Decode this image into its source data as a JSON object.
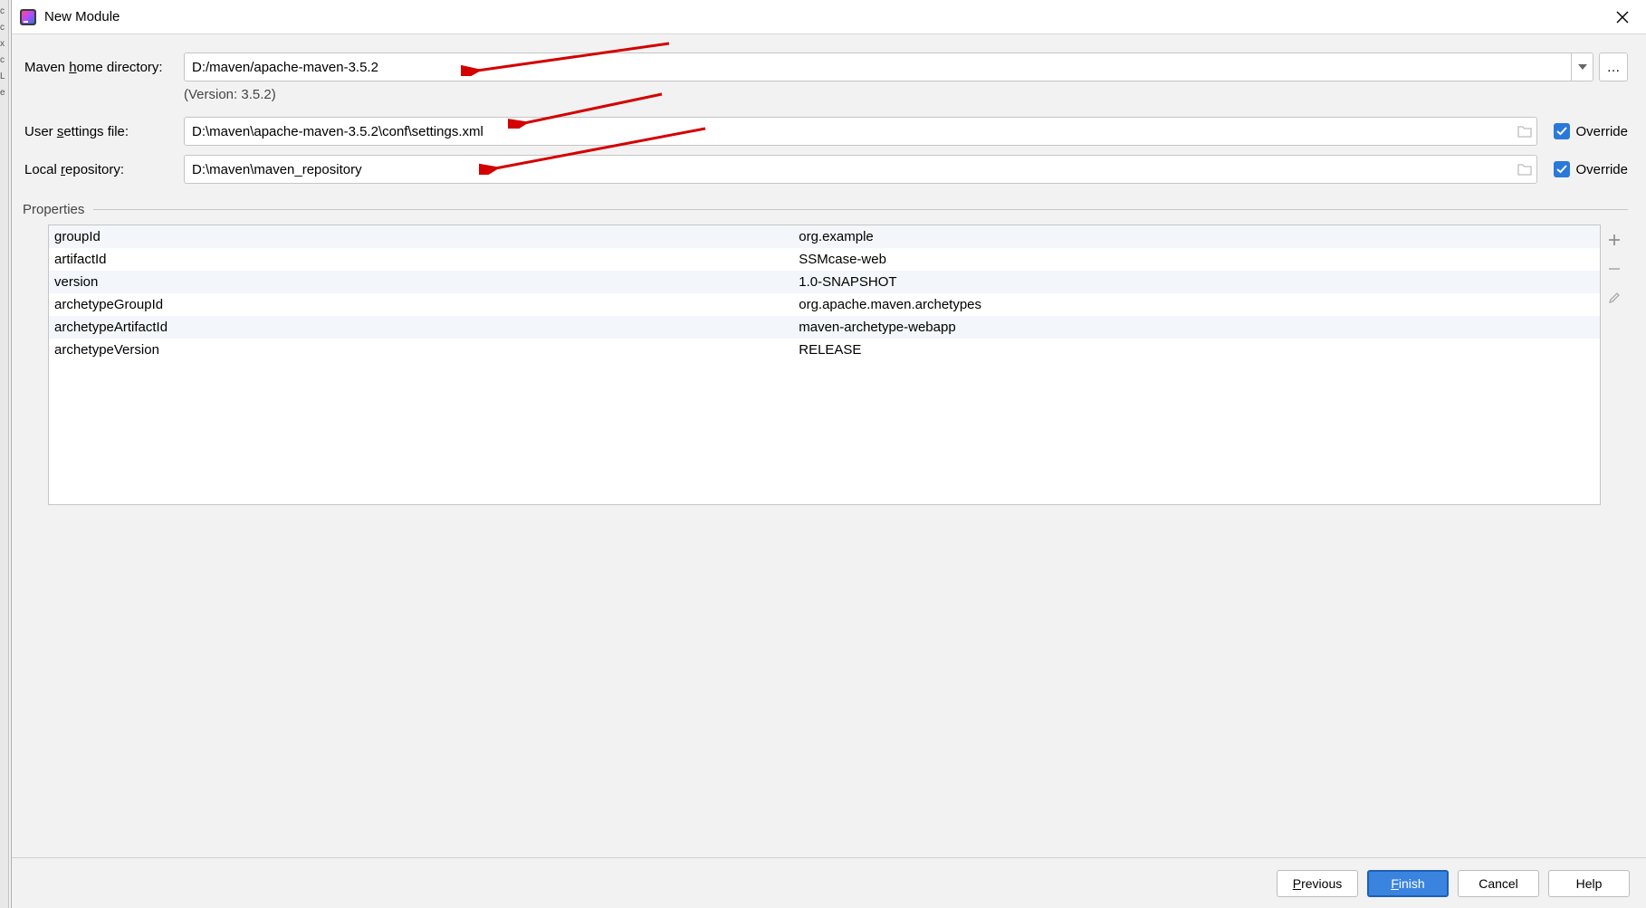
{
  "window": {
    "title": "New Module"
  },
  "labels": {
    "mavenHome": "Maven home directory:",
    "mavenHome_uchar": "h",
    "userSettings": "User settings file:",
    "userSettings_uchar": "s",
    "localRepo": "Local repository:",
    "localRepo_uchar": "r",
    "properties": "Properties",
    "override": "Override"
  },
  "fields": {
    "mavenHome": "D:/maven/apache-maven-3.5.2",
    "versionText": "(Version: 3.5.2)",
    "settingsFile": "D:\\maven\\apache-maven-3.5.2\\conf\\settings.xml",
    "localRepo": "D:\\maven\\maven_repository"
  },
  "checkboxes": {
    "overrideSettings": true,
    "overrideRepo": true
  },
  "properties": [
    {
      "key": "groupId",
      "value": "org.example"
    },
    {
      "key": "artifactId",
      "value": "SSMcase-web"
    },
    {
      "key": "version",
      "value": "1.0-SNAPSHOT"
    },
    {
      "key": "archetypeGroupId",
      "value": "org.apache.maven.archetypes"
    },
    {
      "key": "archetypeArtifactId",
      "value": "maven-archetype-webapp"
    },
    {
      "key": "archetypeVersion",
      "value": "RELEASE"
    }
  ],
  "buttons": {
    "previous": "Previous",
    "finish": "Finish",
    "cancel": "Cancel",
    "help": "Help",
    "ellipsis": "…"
  }
}
